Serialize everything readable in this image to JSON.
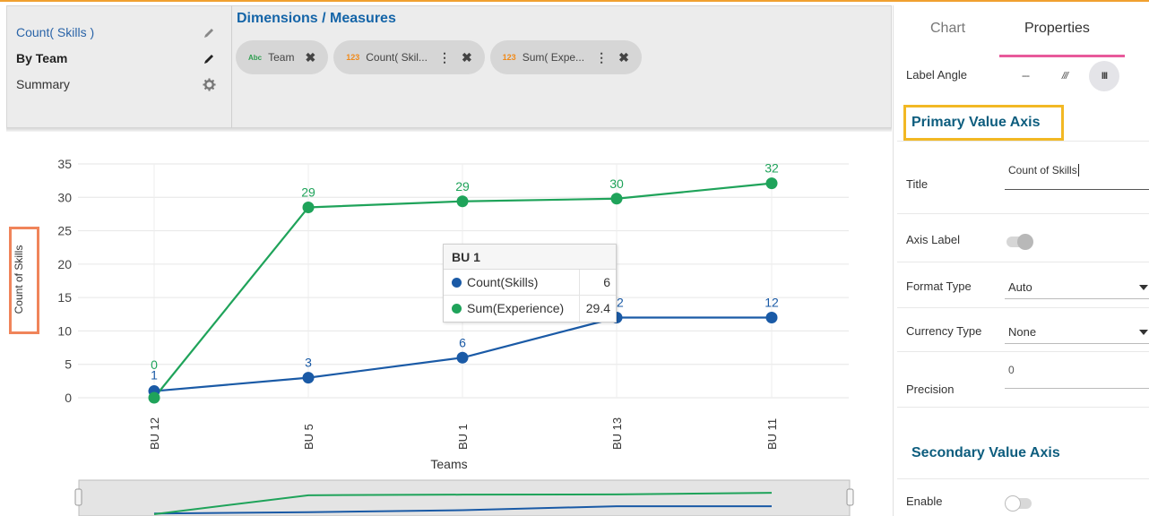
{
  "menu": [
    {
      "label": "Count( Skills )",
      "icon": "pencil-icon"
    },
    {
      "label": "By Team",
      "icon": "pencil-icon"
    },
    {
      "label": "Summary",
      "icon": "gear-icon"
    }
  ],
  "dimensions": {
    "title": "Dimensions / Measures",
    "pills": [
      {
        "type": "Abc",
        "label": "Team"
      },
      {
        "type": "123",
        "label": "Count( Skil..."
      },
      {
        "type": "123",
        "label": "Sum( Expe..."
      }
    ]
  },
  "chart_data": {
    "type": "line",
    "xlabel": "Teams",
    "ylabel": "Count of Skills",
    "ylim": [
      0,
      35
    ],
    "yticks": [
      0,
      5,
      10,
      15,
      20,
      25,
      30,
      35
    ],
    "categories": [
      "BU 12",
      "BU 5",
      "BU 1",
      "BU 13",
      "BU 11"
    ],
    "series": [
      {
        "name": "Count(Skills)",
        "color": "#1a5aa6",
        "values": [
          1,
          3,
          6,
          12,
          12
        ],
        "labels": [
          "1",
          "3",
          "6",
          "12",
          "12"
        ]
      },
      {
        "name": "Sum(Experience)",
        "color": "#1fa35a",
        "values": [
          0,
          28.5,
          29.4,
          29.8,
          32.1
        ],
        "labels": [
          "0",
          "29",
          "29",
          "30",
          "32"
        ]
      }
    ],
    "grid": true
  },
  "tooltip": {
    "title": "BU 1",
    "rows": [
      {
        "name": "Count(Skills)",
        "value": "6",
        "color": "#1a5aa6"
      },
      {
        "name": "Sum(Experience)",
        "value": "29.4",
        "color": "#1fa35a"
      }
    ]
  },
  "panel": {
    "tabs": {
      "chart": "Chart",
      "properties": "Properties"
    },
    "label_angle": "Label Angle",
    "angle_options": [
      "---",
      "///",
      "III"
    ],
    "primary_axis": "Primary Value Axis",
    "title_label": "Title",
    "title_value": "Count of Skills",
    "axis_label": "Axis Label",
    "format_type_label": "Format Type",
    "format_type_value": "Auto",
    "currency_type_label": "Currency Type",
    "currency_type_value": "None",
    "precision_label": "Precision",
    "precision_value": "0",
    "secondary_axis": "Secondary Value Axis",
    "enable_label": "Enable"
  }
}
